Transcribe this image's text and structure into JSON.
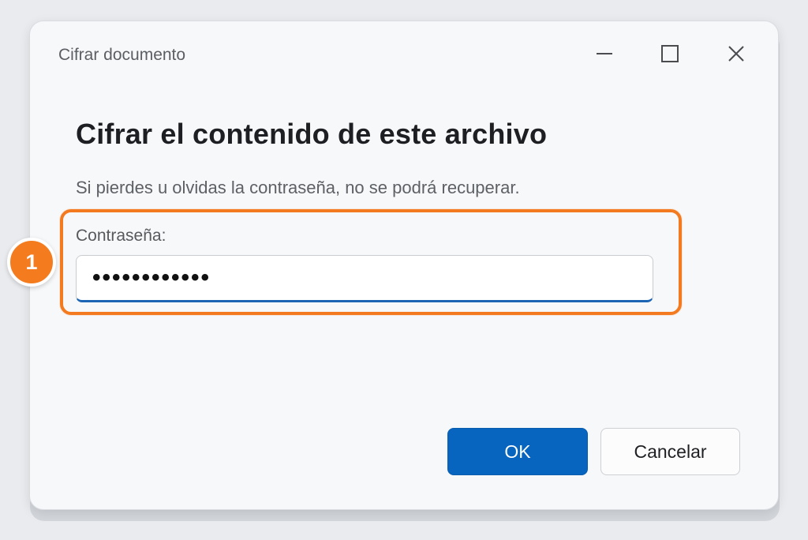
{
  "window": {
    "title": "Cifrar documento",
    "controls": {
      "minimize_icon": "minimize-icon",
      "maximize_icon": "maximize-icon",
      "close_icon": "close-icon"
    }
  },
  "dialog": {
    "heading": "Cifrar el contenido de este archivo",
    "subtext": "Si pierdes u olvidas la contraseña, no se podrá recuperar.",
    "password": {
      "label": "Contraseña:",
      "value": "••••••••••••"
    },
    "buttons": {
      "ok": "OK",
      "cancel": "Cancelar"
    }
  },
  "annotation": {
    "step_number": "1"
  },
  "colors": {
    "accent": "#0765c0",
    "highlight": "#f37a1f",
    "badge": "#f47b1e"
  }
}
